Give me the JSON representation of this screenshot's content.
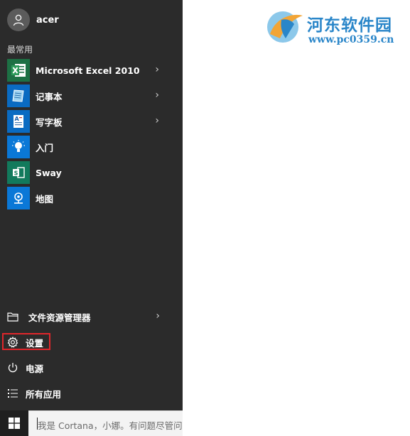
{
  "user": {
    "name": "acer"
  },
  "most_used": {
    "label": "最常用",
    "apps": [
      {
        "label": "Microsoft Excel 2010",
        "icon": "excel-icon",
        "tile_color": "#1d7044",
        "has_arrow": true
      },
      {
        "label": "记事本",
        "icon": "notepad-icon",
        "tile_color": "#0a6bc2",
        "has_arrow": true
      },
      {
        "label": "写字板",
        "icon": "wordpad-icon",
        "tile_color": "#0a6bc2",
        "has_arrow": true
      },
      {
        "label": "入门",
        "icon": "lightbulb-icon",
        "tile_color": "#0a78d7",
        "has_arrow": false
      },
      {
        "label": "Sway",
        "icon": "sway-icon",
        "tile_color": "#127a5c",
        "has_arrow": false
      },
      {
        "label": "地图",
        "icon": "maps-icon",
        "tile_color": "#0a78d7",
        "has_arrow": false
      }
    ]
  },
  "bottom": {
    "file_explorer": "文件资源管理器",
    "settings": "设置",
    "power": "电源",
    "all_apps": "所有应用"
  },
  "taskbar": {
    "search_text": "我是 Cortana，小娜。有问题尽管问我"
  },
  "watermark": {
    "name_cn": "河东软件园",
    "url": "www.pc0359.cn"
  },
  "colors": {
    "menu_bg": "#2b2b2b",
    "highlight": "#e0262b",
    "watermark": "#2a86c9"
  }
}
